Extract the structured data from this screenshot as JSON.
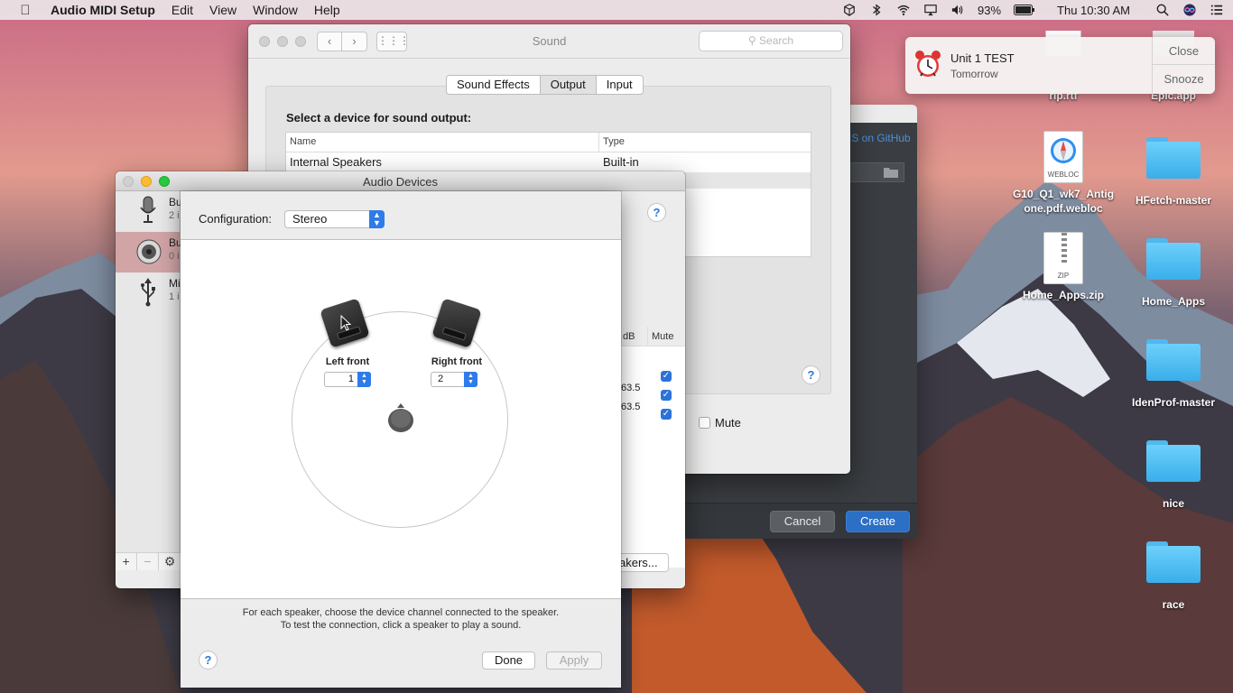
{
  "menubar": {
    "app_name": "Audio MIDI Setup",
    "menus": [
      "Edit",
      "View",
      "Window",
      "Help"
    ],
    "battery": "93%",
    "clock": "Thu 10:30 AM"
  },
  "sound_window": {
    "title": "Sound",
    "search_placeholder": "Search",
    "tabs": [
      {
        "label": "Sound Effects",
        "selected": false
      },
      {
        "label": "Output",
        "selected": true
      },
      {
        "label": "Input",
        "selected": false
      }
    ],
    "heading": "Select a device for sound output:",
    "columns": [
      "Name",
      "Type"
    ],
    "devices": [
      {
        "name": "Internal Speakers",
        "type": "Built-in"
      }
    ],
    "mute_label": "Mute"
  },
  "dark_dialog": {
    "link_text": "IS on GitHub",
    "cancel_label": "Cancel",
    "create_label": "Create"
  },
  "audio_devices_window": {
    "title": "Audio Devices",
    "sidebar": [
      {
        "label": "Bu",
        "sub": "2 i",
        "icon": "microphone-icon",
        "selected": false
      },
      {
        "label": "Bu",
        "sub": "0 i",
        "icon": "speaker-icon",
        "selected": true
      },
      {
        "label": "Mi",
        "sub": "1 i",
        "icon": "usb-icon",
        "selected": false
      }
    ],
    "toolbar": {
      "add": "+",
      "remove": "−",
      "gear": "⚙"
    },
    "volume_columns": [
      "dB",
      "Mute"
    ],
    "volume_rows": [
      {
        "db": "",
        "muted": true
      },
      {
        "db": "63.5",
        "muted": true
      },
      {
        "db": "63.5",
        "muted": true
      }
    ],
    "configure_speakers_label": "akers..."
  },
  "speaker_sheet": {
    "config_label": "Configuration:",
    "config_value": "Stereo",
    "speakers": [
      {
        "label": "Left front",
        "channel": "1"
      },
      {
        "label": "Right front",
        "channel": "2"
      }
    ],
    "hint_line1": "For each speaker, choose the device channel connected to the speaker.",
    "hint_line2": "To test the connection, click a speaker to play a sound.",
    "done_label": "Done",
    "apply_label": "Apply"
  },
  "notification": {
    "title": "Unit 1 TEST",
    "subtitle": "Tomorrow",
    "close_label": "Close",
    "snooze_label": "Snooze"
  },
  "desktop_icons": [
    {
      "name": "rip.rtf"
    },
    {
      "name": "Epic.app"
    },
    {
      "name": "G10_Q1_wk7_Antigone.pdf.webloc",
      "line1": "G10_Q1_wk7_Antig",
      "line2": "one.pdf.webloc",
      "badge": "WEBLOC"
    },
    {
      "name": "HFetch-master"
    },
    {
      "name": "Home_Apps.zip",
      "badge": "ZIP"
    },
    {
      "name": "Home_Apps"
    },
    {
      "name": "IdenProf-master"
    },
    {
      "name": "nice"
    },
    {
      "name": "race"
    }
  ],
  "colors": {
    "accent": "#2e7bea",
    "selection": "#d1a4a6",
    "folder": "#4fb8ef"
  }
}
